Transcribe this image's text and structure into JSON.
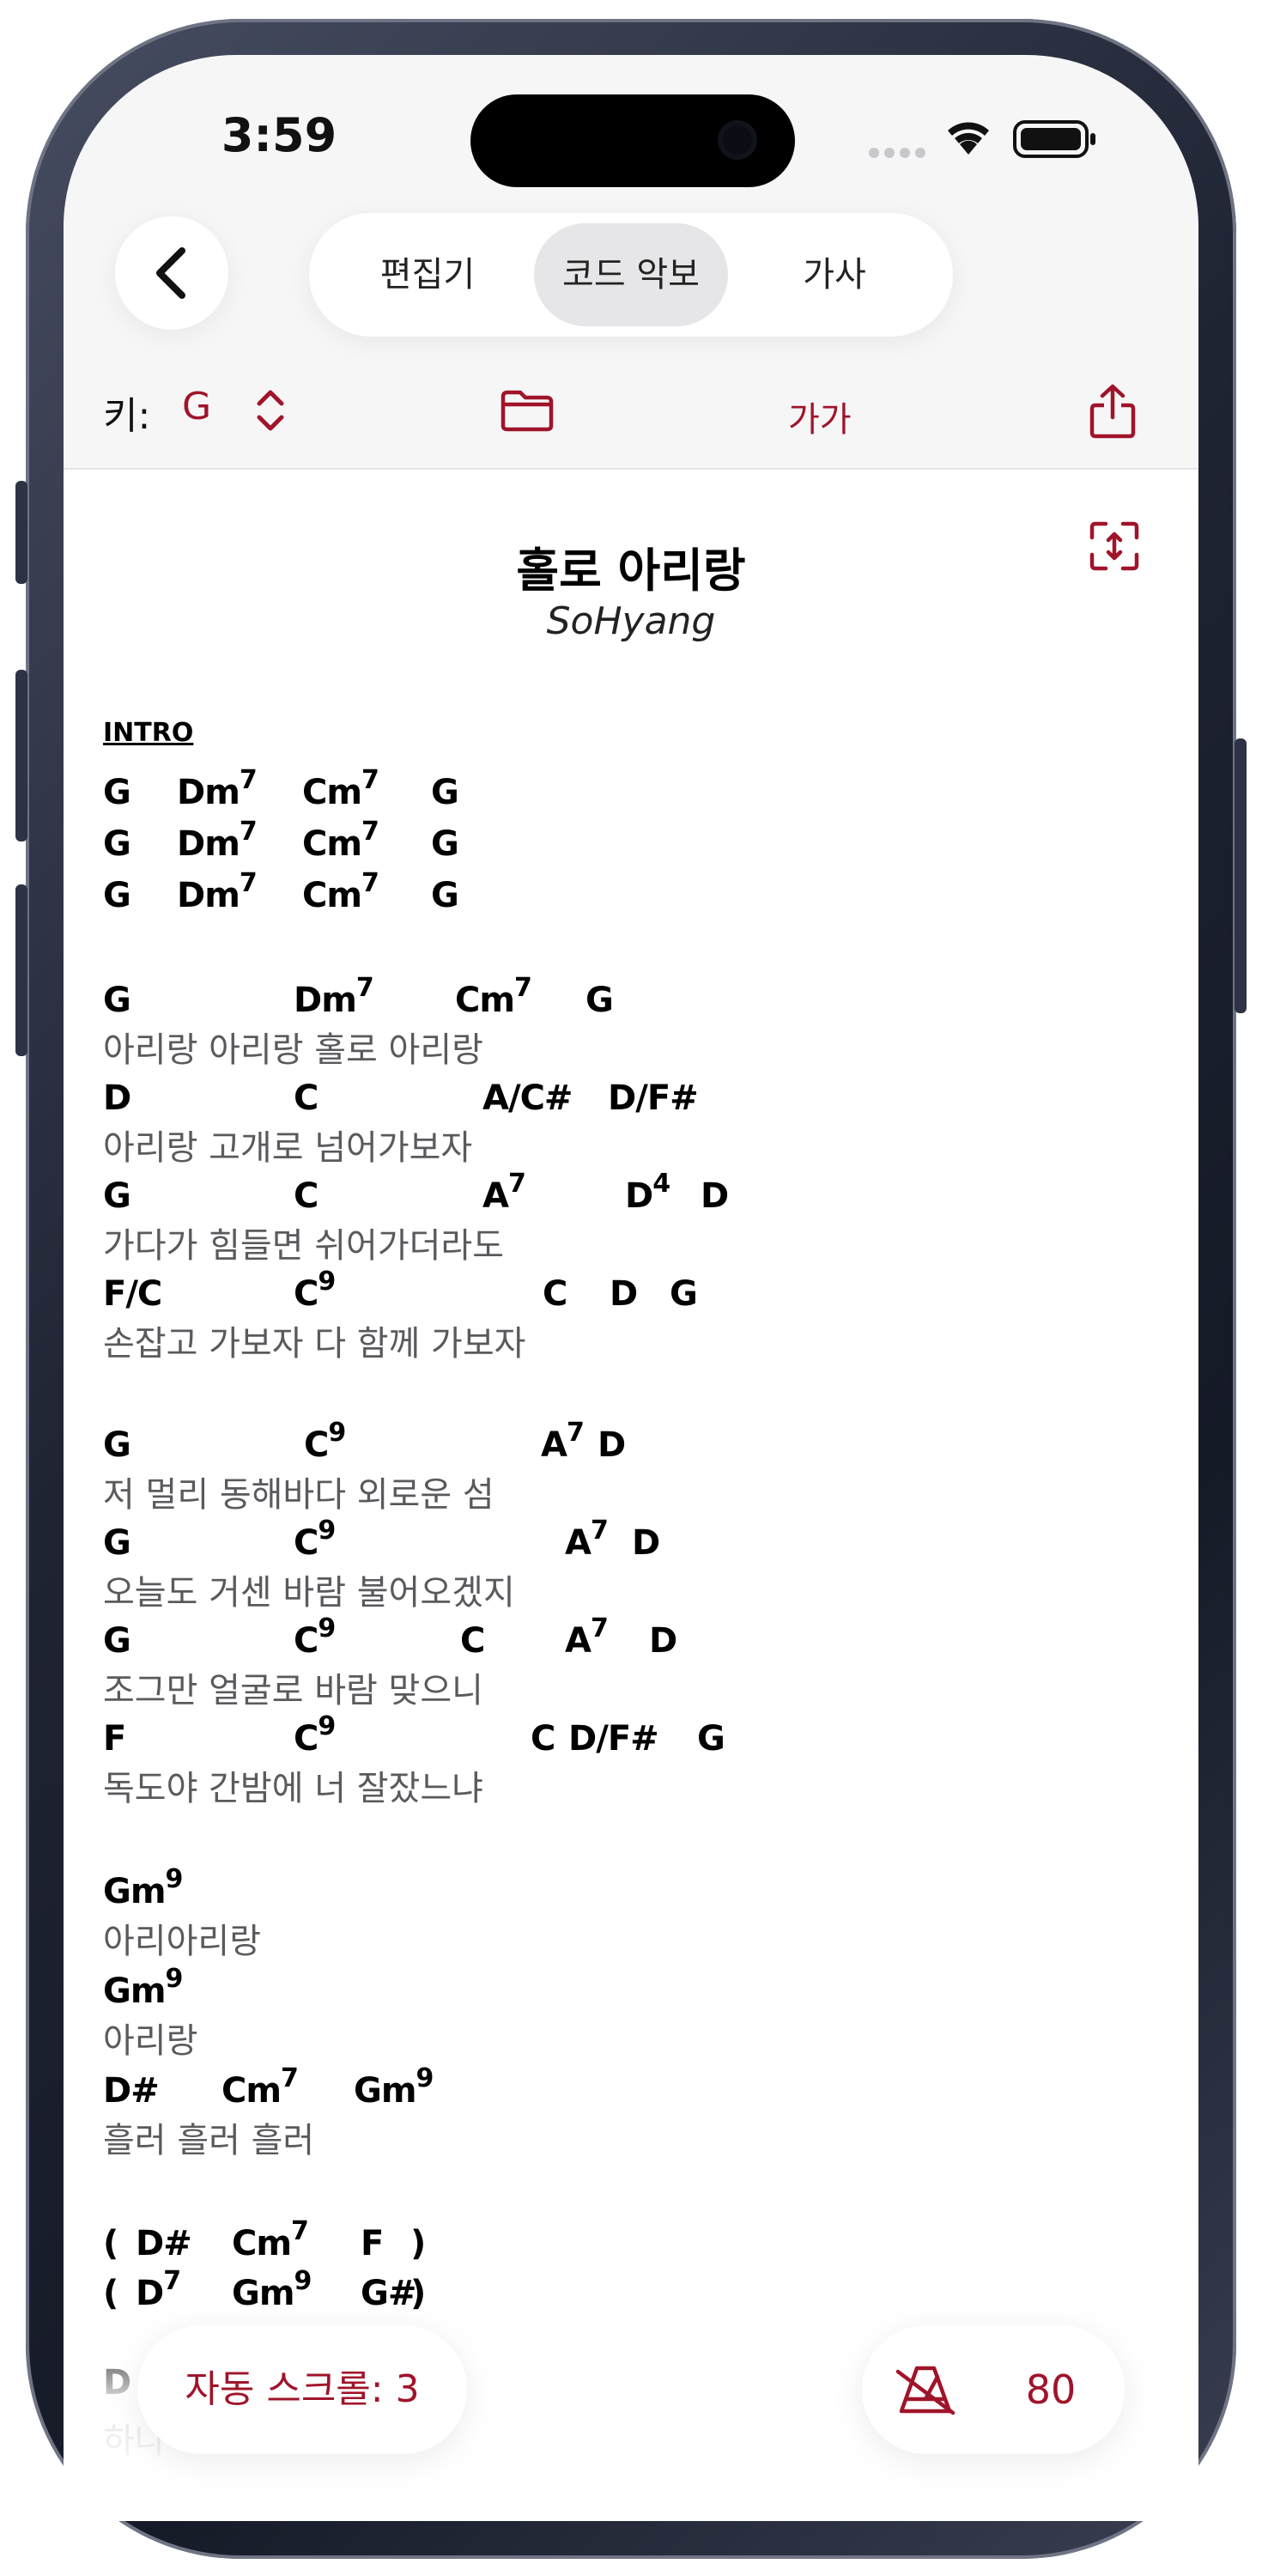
{
  "status": {
    "time": "3:59"
  },
  "nav": {
    "tabs": [
      {
        "label": "편집기"
      },
      {
        "label": "코드 악보",
        "selected": true
      },
      {
        "label": "가사"
      }
    ]
  },
  "toolbar": {
    "key_label": "키:",
    "key_value": "G",
    "font_size_label": "가가"
  },
  "song": {
    "title": "홀로 아리랑",
    "artist": "SoHyang"
  },
  "sheet": {
    "intro_label": "INTRO",
    "lines": [
      {
        "type": "chords",
        "items": [
          [
            "G",
            ""
          ],
          [
            "Dm",
            "7"
          ],
          [
            "Cm",
            "7"
          ],
          [
            "G",
            ""
          ]
        ]
      },
      {
        "type": "chords",
        "items": [
          [
            "G",
            ""
          ],
          [
            "Dm",
            "7"
          ],
          [
            "Cm",
            "7"
          ],
          [
            "G",
            ""
          ]
        ]
      },
      {
        "type": "chords",
        "items": [
          [
            "G",
            ""
          ],
          [
            "Dm",
            "7"
          ],
          [
            "Cm",
            "7"
          ],
          [
            "G",
            ""
          ]
        ]
      },
      {
        "type": "chords",
        "items": [
          [
            "G",
            ""
          ],
          [
            "Dm",
            "7"
          ],
          [
            "Cm",
            "7"
          ],
          [
            "G",
            ""
          ]
        ]
      },
      {
        "type": "lyric",
        "text": "아리랑 아리랑 홀로 아리랑"
      },
      {
        "type": "chords",
        "items": [
          [
            "D",
            ""
          ],
          [
            "C",
            ""
          ],
          [
            "A/C#",
            ""
          ],
          [
            "D/F#",
            ""
          ]
        ]
      },
      {
        "type": "lyric",
        "text": "아리랑 고개로 넘어가보자"
      },
      {
        "type": "chords",
        "items": [
          [
            "G",
            ""
          ],
          [
            "C",
            ""
          ],
          [
            "A",
            "7"
          ],
          [
            "D",
            "4"
          ],
          [
            "D",
            ""
          ]
        ]
      },
      {
        "type": "lyric",
        "text": "가다가 힘들면 쉬어가더라도"
      },
      {
        "type": "chords",
        "items": [
          [
            "F/C",
            ""
          ],
          [
            "C",
            "9"
          ],
          [
            "C",
            ""
          ],
          [
            "D",
            ""
          ],
          [
            "G",
            ""
          ]
        ]
      },
      {
        "type": "lyric",
        "text": "손잡고 가보자 다 함께 가보자"
      },
      {
        "type": "chords",
        "items": [
          [
            "G",
            ""
          ],
          [
            "C",
            "9"
          ],
          [
            "A",
            "7"
          ],
          [
            "D",
            ""
          ]
        ]
      },
      {
        "type": "lyric",
        "text": "저 멀리 동해바다 외로운 섬"
      },
      {
        "type": "chords",
        "items": [
          [
            "G",
            ""
          ],
          [
            "C",
            "9"
          ],
          [
            "A",
            "7"
          ],
          [
            "D",
            ""
          ]
        ]
      },
      {
        "type": "lyric",
        "text": "오늘도 거센 바람 불어오겠지"
      },
      {
        "type": "chords",
        "items": [
          [
            "G",
            ""
          ],
          [
            "C",
            "9"
          ],
          [
            "C",
            ""
          ],
          [
            "A",
            "7"
          ],
          [
            "D",
            ""
          ]
        ]
      },
      {
        "type": "lyric",
        "text": "조그만 얼굴로 바람 맞으니"
      },
      {
        "type": "chords",
        "items": [
          [
            "F",
            ""
          ],
          [
            "C",
            "9"
          ],
          [
            "C",
            ""
          ],
          [
            "D/F#",
            ""
          ],
          [
            "G",
            ""
          ]
        ]
      },
      {
        "type": "lyric",
        "text": "독도야 간밤에 너 잘잤느냐"
      },
      {
        "type": "chords",
        "items": [
          [
            "Gm",
            "9"
          ]
        ]
      },
      {
        "type": "lyric",
        "text": "아리아리랑"
      },
      {
        "type": "chords",
        "items": [
          [
            "Gm",
            "9"
          ]
        ]
      },
      {
        "type": "lyric",
        "text": "아리랑"
      },
      {
        "type": "chords",
        "items": [
          [
            "D#",
            ""
          ],
          [
            "Cm",
            "7"
          ],
          [
            "Gm",
            "9"
          ]
        ]
      },
      {
        "type": "lyric",
        "text": "흘러 흘러 흘러"
      },
      {
        "type": "chords",
        "items": [
          [
            "(",
            ""
          ],
          [
            "D#",
            ""
          ],
          [
            "Cm",
            "7"
          ],
          [
            "F",
            ""
          ],
          [
            ")",
            ""
          ]
        ]
      },
      {
        "type": "chords",
        "items": [
          [
            "(",
            ""
          ],
          [
            "D",
            "7"
          ],
          [
            "Gm",
            "9"
          ],
          [
            "G#",
            ""
          ],
          [
            ")",
            ""
          ]
        ]
      },
      {
        "type": "chords",
        "items": [
          [
            "D",
            ""
          ]
        ]
      },
      {
        "type": "lyric",
        "text": "하나"
      }
    ]
  },
  "bottom": {
    "autoscroll_label": "자동 스크롤: 3",
    "tempo_value": "80"
  },
  "colors": {
    "accent": "#a0142a",
    "chord": "#000000",
    "lyric": "#5a5a5e"
  }
}
